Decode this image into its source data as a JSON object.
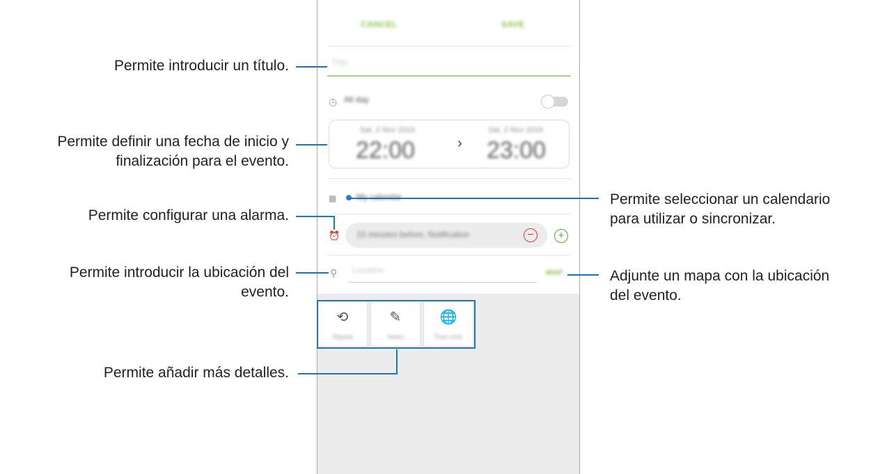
{
  "callouts": {
    "title": "Permite introducir un título.",
    "date_line1": "Permite definir una fecha de inicio y",
    "date_line2": "finalización para el evento.",
    "alarm": "Permite configurar una alarma.",
    "location_line1": "Permite introducir la ubicación del",
    "location_line2": "evento.",
    "details": "Permite añadir más detalles.",
    "calendar_line1": "Permite seleccionar un calendario",
    "calendar_line2": "para utilizar o sincronizar.",
    "map_line1": "Adjunte un mapa con la ubicación",
    "map_line2": "del evento."
  },
  "screen": {
    "cancel_label": "CANCEL",
    "save_label": "SAVE",
    "title_placeholder": "Title",
    "all_day_label": "All day",
    "start_date": "Sat, 2 Nov 2019",
    "start_time": "22:00",
    "end_date": "Sat, 2 Nov 2019",
    "end_time": "23:00",
    "calendar_name": "My calendar",
    "alarm_text": "15 minutes before, Notification",
    "location_placeholder": "Location",
    "map_button": "MAP",
    "tiles": [
      {
        "label": "Repeat",
        "icon": "repeat-icon"
      },
      {
        "label": "Notes",
        "icon": "notes-icon"
      },
      {
        "label": "Time zone",
        "icon": "globe-clock-icon"
      }
    ]
  },
  "colors": {
    "accent_green": "#8bc34a",
    "callout_line": "#1b75bc",
    "calendar_dot": "#2e7dd6",
    "minus_red": "#c94040",
    "plus_green": "#5aa33b"
  }
}
